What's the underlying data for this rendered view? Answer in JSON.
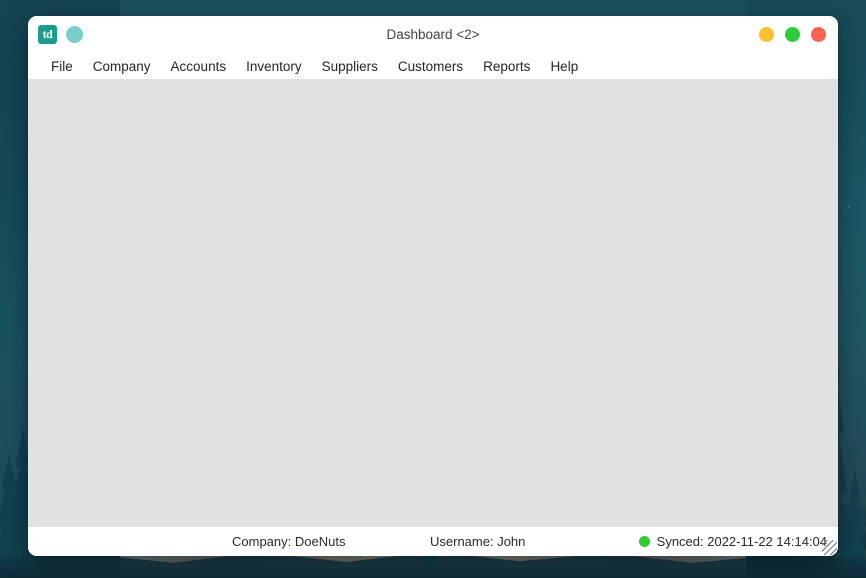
{
  "desktop": {
    "wallpaper_name": "forest-sunset-wallpaper",
    "colors": {
      "sky_top": "#1d4f5e",
      "sky_horizon": "#fbeac4",
      "forest": "#11404f"
    }
  },
  "window": {
    "title": "Dashboard <2>",
    "logo_text": "td",
    "logo_color": "#1b9c8e",
    "status_dot_color": "#79cfc9",
    "controls": [
      {
        "name": "minimize",
        "label": "Minimize",
        "color": "#fbc02d"
      },
      {
        "name": "maximize",
        "label": "Maximize",
        "color": "#2bcc3c"
      },
      {
        "name": "close",
        "label": "Close",
        "color": "#fb6050"
      }
    ]
  },
  "menubar": {
    "items": [
      {
        "label": "File"
      },
      {
        "label": "Company"
      },
      {
        "label": "Accounts"
      },
      {
        "label": "Inventory"
      },
      {
        "label": "Suppliers"
      },
      {
        "label": "Customers"
      },
      {
        "label": "Reports"
      },
      {
        "label": "Help"
      }
    ]
  },
  "content": {
    "background_color": "#e1e1e1",
    "body_text": ""
  },
  "statusbar": {
    "company": "Company: DoeNuts",
    "username": "Username: John",
    "sync_status": "Synced: 2022-11-22 14:14:04",
    "sync_indicator_color": "#2fcc2f"
  }
}
